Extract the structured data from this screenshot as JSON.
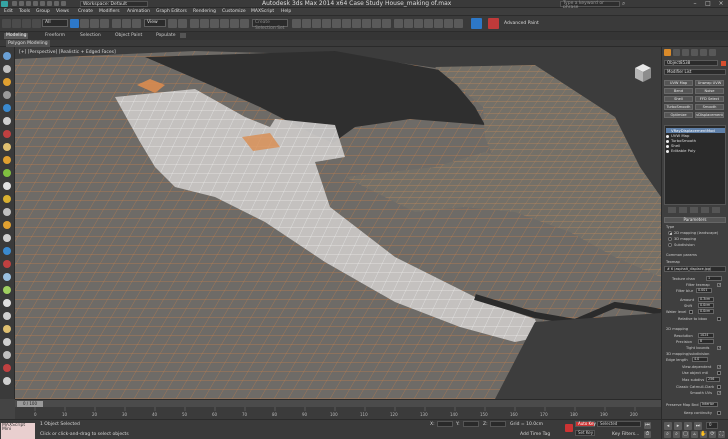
{
  "window": {
    "title": "Autodesk 3ds Max  2014 x64       Case Study House_making of.max",
    "workspace": "Workspace: Default",
    "search_placeholder": "Type a keyword or phrase",
    "win_buttons": [
      "–",
      "□",
      "×"
    ]
  },
  "menu": [
    "Edit",
    "Tools",
    "Group",
    "Views",
    "Create",
    "Modifiers",
    "Animation",
    "Graph Editors",
    "Rendering",
    "Customize",
    "MAXScript",
    "Help"
  ],
  "toolbar": {
    "selection_filter": "All",
    "ref_coord": "View",
    "named_selection": "Create Selection Set",
    "advanced_paint": "Advanced Paint"
  },
  "ribbon": {
    "tabs": [
      "Modeling",
      "Freeform",
      "Selection",
      "Object Paint",
      "Populate"
    ],
    "active_tab": 0,
    "sub_label": "Polygon Modeling"
  },
  "viewport": {
    "label": "[+] [Perspective] [Realistic + Edged Faces]"
  },
  "command_panel": {
    "object_name": "Object8538",
    "color": "#d64f2f",
    "modifier_list": "Modifier List",
    "modifier_buttons": [
      [
        "UVW Map",
        "Unwrap UVW"
      ],
      [
        "Bend",
        "Noise"
      ],
      [
        "Shell",
        "FFD Select"
      ],
      [
        "TurboSmooth",
        "Smooth"
      ],
      [
        "Optimize",
        "vDisplacement"
      ]
    ],
    "stack": [
      {
        "label": "VRayDisplacementMod",
        "selected": true
      },
      {
        "label": "UVW Map",
        "selected": false
      },
      {
        "label": "TurboSmooth",
        "selected": false
      },
      {
        "label": "Shell",
        "selected": false
      },
      {
        "label": "Editable Poly",
        "selected": false
      }
    ],
    "parameters": {
      "header": "Parameters",
      "type_label": "Type",
      "type_options": [
        {
          "label": "2D mapping (landscape)",
          "selected": true
        },
        {
          "label": "3D mapping",
          "selected": false
        },
        {
          "label": "Subdivision",
          "selected": false
        }
      ],
      "common_params": "Common params",
      "texmap_label": "Texmap",
      "texmap_value": "# 6 (asphalt_displace.jpg)",
      "texture_chan_label": "Texture chan",
      "texture_chan_value": "1",
      "filter_texmap": "Filter texmap",
      "filter_blur_label": "Filter blur",
      "filter_blur_value": "0.001",
      "amount_label": "Amount",
      "amount_value": "0.3cm",
      "shift_label": "Shift",
      "shift_value": "0.0cm",
      "water_level_label": "Water level",
      "water_level_value": "0.0cm",
      "relative_bbox": "Relative to bbox",
      "mapping_2d": "2D mapping",
      "resolution_label": "Resolution",
      "resolution_value": "1024",
      "precision_label": "Precision",
      "precision_value": "8",
      "tight_bounds": "Tight bounds",
      "mapping_3d": "3D mapping/subdivision",
      "edge_length_label": "Edge length",
      "edge_length_value": "4.0",
      "view_dependent": "View-dependent",
      "use_object_mtl": "Use object mtl",
      "max_subdivs_label": "Max subdivs",
      "max_subdivs_value": "256",
      "classic_catmull": "Classic Catmull-Clark",
      "smooth_uvs": "Smooth UVs",
      "preserve_map_bnd_label": "Preserve Map Bnd",
      "preserve_map_bnd_value": "Interior",
      "keep_continuity": "Keep continuity"
    }
  },
  "timeslider": {
    "label": "0 / 100",
    "ticks": [
      "0",
      "10",
      "20",
      "30",
      "40",
      "50",
      "60",
      "70",
      "80",
      "90",
      "100",
      "110",
      "120",
      "130",
      "140",
      "150",
      "160",
      "170",
      "180",
      "190",
      "200"
    ]
  },
  "status": {
    "badge": "MAXScript Mini",
    "selected": "1 Object Selected",
    "prompt": "Click or click-and-drag to select objects",
    "x_label": "X:",
    "y_label": "Y:",
    "z_label": "Z:",
    "grid": "Grid = 10.0cm",
    "auto_key": "Auto Key",
    "set_key": "Set Key",
    "selected_dropdown": "Selected",
    "key_filters": "Key Filters...",
    "add_time_tag": "Add Time Tag",
    "frame": "0"
  }
}
